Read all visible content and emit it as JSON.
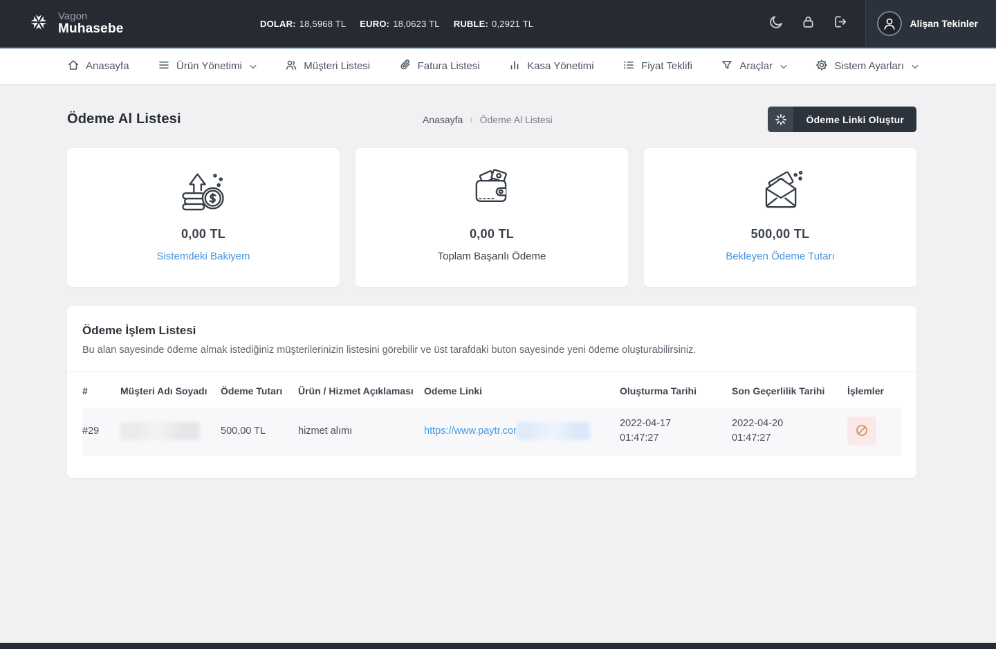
{
  "header": {
    "logo": {
      "top": "Vagon",
      "bottom": "Muhasebe"
    },
    "rates": [
      {
        "label": "DOLAR:",
        "value": "18,5968 TL"
      },
      {
        "label": "EURO:",
        "value": "18,0623 TL"
      },
      {
        "label": "RUBLE:",
        "value": "0,2921 TL"
      }
    ],
    "user": {
      "name": "Alişan Tekinler"
    }
  },
  "nav": {
    "items": [
      {
        "label": "Anasayfa"
      },
      {
        "label": "Ürün Yönetimi"
      },
      {
        "label": "Müşteri Listesi"
      },
      {
        "label": "Fatura Listesi"
      },
      {
        "label": "Kasa Yönetimi"
      },
      {
        "label": "Fiyat Teklifi"
      },
      {
        "label": "Araçlar"
      },
      {
        "label": "Sistem Ayarları"
      }
    ]
  },
  "page": {
    "title": "Ödeme Al Listesi",
    "breadcrumb": {
      "home": "Anasayfa",
      "separator": "›",
      "current": "Ödeme Al Listesi"
    },
    "action_button": "Ödeme Linki Oluştur"
  },
  "cards": [
    {
      "value": "0,00 TL",
      "label": "Sistemdeki Bakiyem",
      "icon": "coins-up-icon"
    },
    {
      "value": "0,00 TL",
      "label": "Toplam Başarılı Ödeme",
      "icon": "wallet-icon"
    },
    {
      "value": "500,00 TL",
      "label": "Bekleyen Ödeme Tutarı",
      "icon": "envelope-money-icon"
    }
  ],
  "table": {
    "title": "Ödeme İşlem Listesi",
    "description": "Bu alan sayesinde ödeme almak istediğiniz müşterilerinizin listesini görebilir ve üst tarafdaki buton sayesinde yeni ödeme oluşturabilirsiniz.",
    "columns": [
      "#",
      "Müşteri Adı Soyadı",
      "Ödeme Tutarı",
      "Ürün / Hizmet Açıklaması",
      "Odeme Linki",
      "Oluşturma Tarihi",
      "Son Geçerlilik Tarihi",
      "İşlemler"
    ],
    "rows": [
      {
        "id": "#29",
        "amount": "500,00 TL",
        "description": "hizmet alımı",
        "link_visible": "https://www.paytr.cor",
        "created_date": "2022-04-17",
        "created_time": "01:47:27",
        "expiry_date": "2022-04-20",
        "expiry_time": "01:47:27"
      }
    ]
  },
  "colors": {
    "header_bg": "#262b33",
    "accent_blue": "#4593dd",
    "link_blue": "#3f9ae8",
    "danger_bg": "#fbe8e8",
    "danger_icon": "#c9935b",
    "page_bg": "#f1f1f3"
  }
}
